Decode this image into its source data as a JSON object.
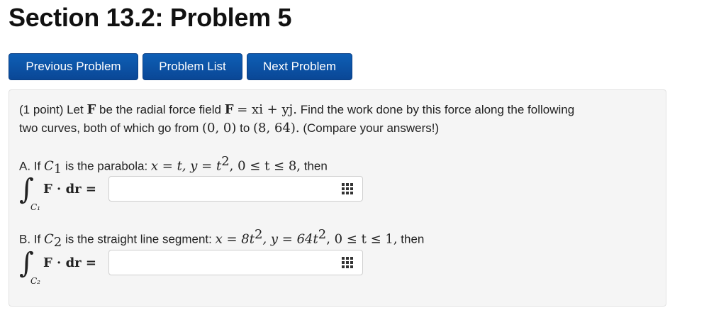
{
  "page": {
    "title": "Section 13.2: Problem 5"
  },
  "nav": {
    "previous_label": "Previous Problem",
    "list_label": "Problem List",
    "next_label": "Next Problem"
  },
  "problem": {
    "intro_1": "(1 point) Let",
    "F": "F",
    "intro_2": "be the radial force field",
    "field_expr_F": "F",
    "field_expr_rest": "= xi + yj.",
    "intro_3": "Find the work done by this force along the following",
    "line2_a": "two curves, both of which go from",
    "start_point": "(0, 0)",
    "to": "to",
    "end_point": "(8, 64).",
    "line2_b": "(Compare your answers!)"
  },
  "part_a": {
    "prefix": "A. If",
    "curve": "C",
    "curve_sub": "1",
    "text": "is the parabola:",
    "param": "x = t,  y = t",
    "param_sup": "2",
    "range": ",  0 ≤ t ≤ 8,",
    "suffix": "then",
    "integral_sub": "C₁",
    "integrand": "F · dr =",
    "answer_value": ""
  },
  "part_b": {
    "prefix": "B. If",
    "curve": "C",
    "curve_sub": "2",
    "text": "is the straight line segment:",
    "param_x": "x = 8t",
    "param_x_sup": "2",
    "param_y": ",  y = 64t",
    "param_y_sup": "2",
    "range": ",  0 ≤ t ≤ 1,",
    "suffix": "then",
    "integral_sub": "C₂",
    "integrand": "F · dr =",
    "answer_value": ""
  },
  "icons": {
    "palette": "equation-palette-icon"
  }
}
